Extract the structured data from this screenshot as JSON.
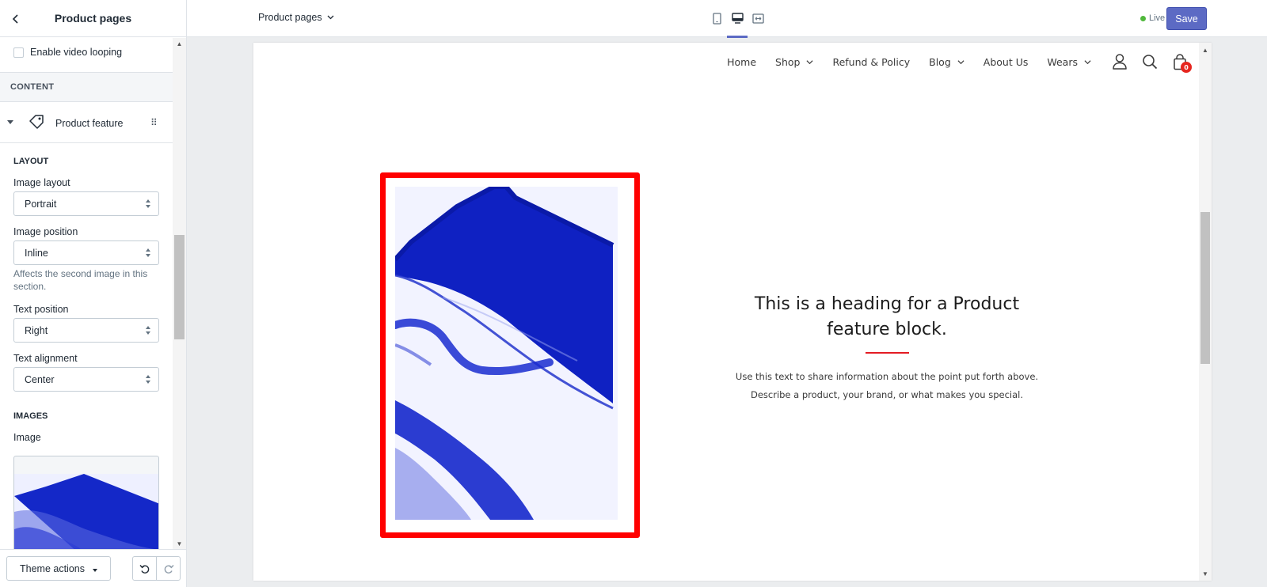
{
  "sidebar": {
    "title": "Product pages",
    "enable_video_looping": {
      "label": "Enable video looping",
      "checked": false
    },
    "content_heading": "CONTENT",
    "block": {
      "label": "Product feature",
      "icon": "tag-icon"
    },
    "layout_heading": "LAYOUT",
    "image_layout": {
      "label": "Image layout",
      "value": "Portrait"
    },
    "image_position": {
      "label": "Image position",
      "value": "Inline",
      "help": "Affects the second image in this section."
    },
    "text_position": {
      "label": "Text position",
      "value": "Right"
    },
    "text_alignment": {
      "label": "Text alignment",
      "value": "Center"
    },
    "images_heading": "IMAGES",
    "image_label": "Image",
    "footer": {
      "theme_actions": "Theme actions",
      "undo_icon": "undo-icon",
      "redo_icon": "redo-icon"
    }
  },
  "topbar": {
    "page_selector": "Product pages",
    "devices": [
      "mobile-icon",
      "desktop-icon",
      "fullwidth-icon"
    ],
    "active_device": "desktop-icon",
    "live_label": "Live",
    "save_label": "Save",
    "colors": {
      "accent": "#5c6ac4",
      "live": "#50b83c"
    }
  },
  "preview": {
    "nav": [
      {
        "label": "Home",
        "dropdown": false
      },
      {
        "label": "Shop",
        "dropdown": true
      },
      {
        "label": "Refund & Policy",
        "dropdown": false
      },
      {
        "label": "Blog",
        "dropdown": true
      },
      {
        "label": "About Us",
        "dropdown": false
      },
      {
        "label": "Wears",
        "dropdown": true
      }
    ],
    "icons": [
      "account-icon",
      "search-icon",
      "cart-icon"
    ],
    "cart_count": "0",
    "feature": {
      "heading": "This is a heading for a Product feature block.",
      "body": "Use this text to share information about the point put forth above. Describe a product, your brand, or what makes you special.",
      "highlight_color": "#ff0000",
      "rule_color": "#e31b23",
      "image_color": "#1a2fd8"
    }
  }
}
